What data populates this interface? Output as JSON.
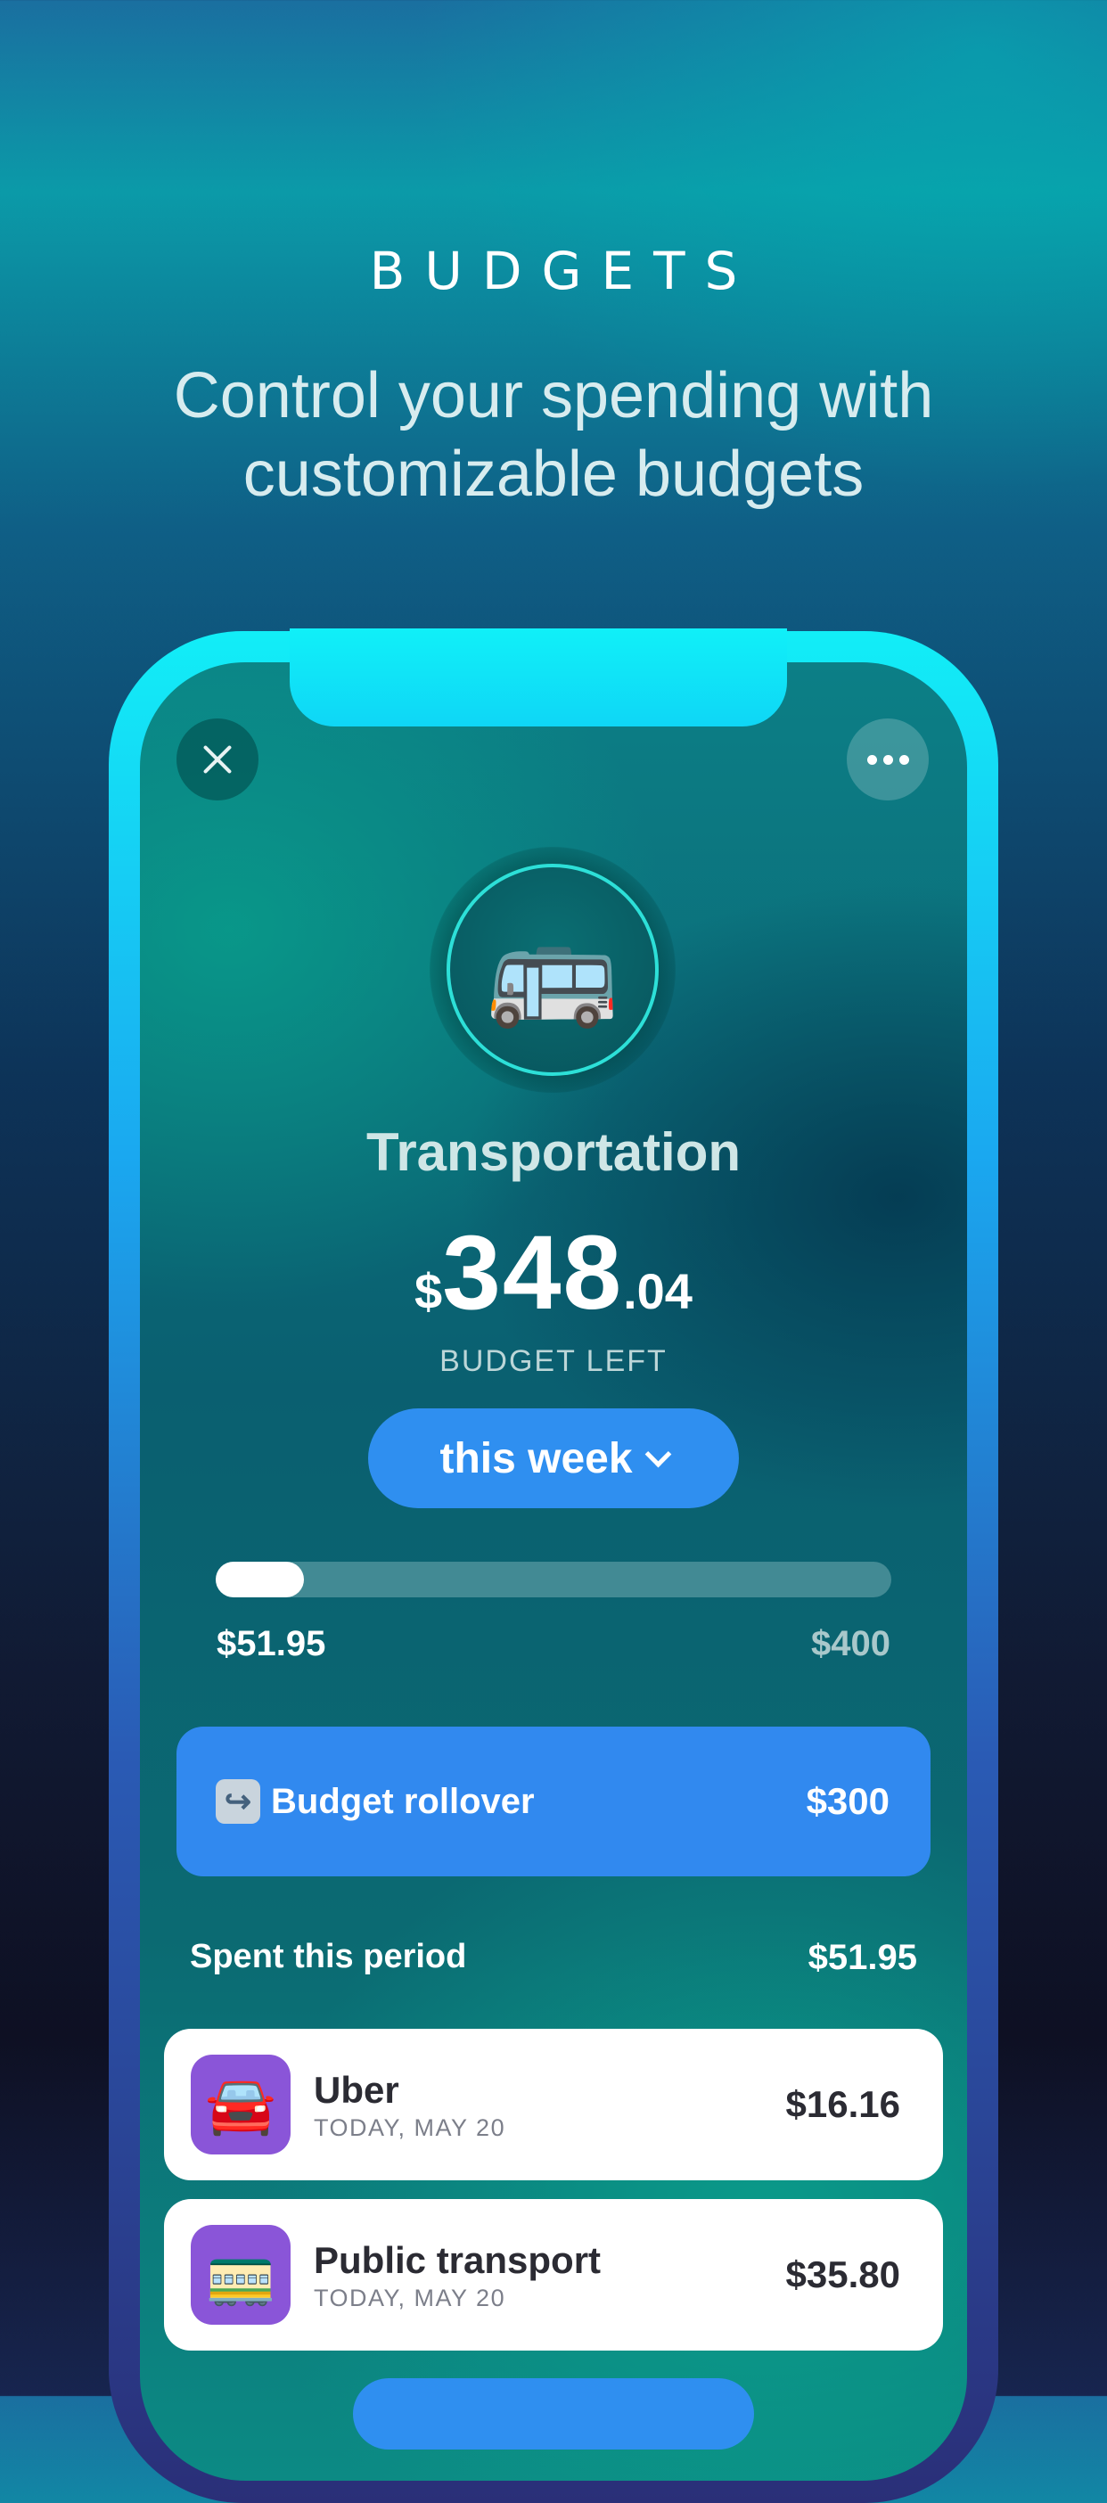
{
  "promo": {
    "title": "BUDGETS",
    "subtitle_line1": "Control your spending with",
    "subtitle_line2": "customizable budgets"
  },
  "budget": {
    "emoji": "🚌",
    "category": "Transportation",
    "amount_currency": "$",
    "amount_whole": "348",
    "amount_cents": ".04",
    "amount_caption": "BUDGET LEFT",
    "period_label": "this week",
    "progress": {
      "spent": "$51.95",
      "total": "$400",
      "fraction": 0.13
    },
    "rollover": {
      "icon": "↪",
      "label": "Budget rollover",
      "amount": "$300"
    },
    "spent_section": {
      "label": "Spent this period",
      "amount": "$51.95"
    },
    "transactions": [
      {
        "emoji": "🚘",
        "name": "Uber",
        "date": "TODAY, MAY 20",
        "amount": "$16.16"
      },
      {
        "emoji": "🚃",
        "name": "Public transport",
        "date": "TODAY, MAY 20",
        "amount": "$35.80"
      }
    ]
  },
  "colors": {
    "accent": "#2f8ff0",
    "phone_frame": "#12eef7",
    "tx_icon_bg": "#8a55d8"
  },
  "icons": {
    "close": "close-icon",
    "more": "more-dots-icon",
    "chevron": "chevron-down-icon",
    "rollover": "rollover-arrow-icon"
  }
}
